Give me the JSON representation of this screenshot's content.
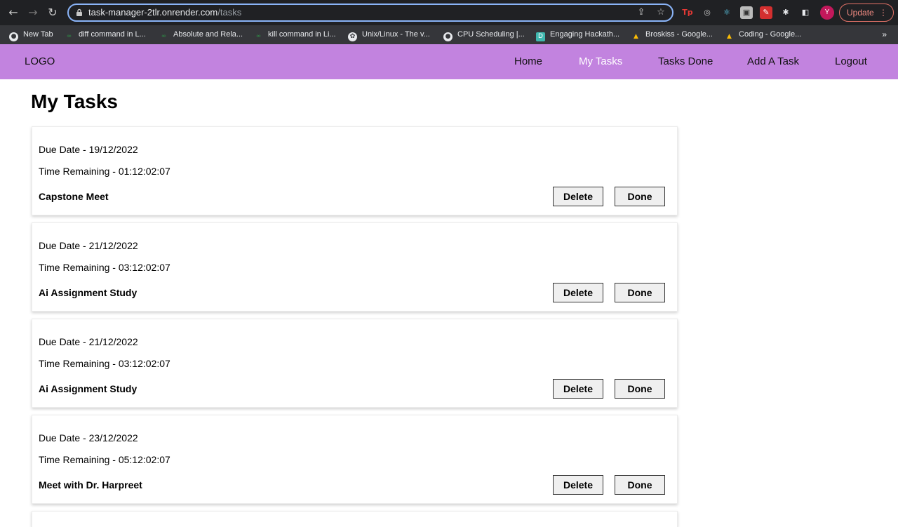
{
  "browser": {
    "url_host": "task-manager-2tlr.onrender.com",
    "url_path": "/tasks",
    "avatar_letter": "Y",
    "update_label": "Update",
    "bookmarks": [
      {
        "label": "New Tab",
        "icon": "globe-icon"
      },
      {
        "label": "diff command in L...",
        "icon": "gfg-icon"
      },
      {
        "label": "Absolute and Rela...",
        "icon": "gfg-icon"
      },
      {
        "label": "kill command in Li...",
        "icon": "gfg-icon"
      },
      {
        "label": "Unix/Linux - The v...",
        "icon": "chatgpt-icon"
      },
      {
        "label": "CPU Scheduling |...",
        "icon": "globe-icon"
      },
      {
        "label": "Engaging Hackath...",
        "icon": "devpost-icon"
      },
      {
        "label": "Broskiss - Google...",
        "icon": "drive-icon"
      },
      {
        "label": "Coding - Google...",
        "icon": "drive-icon"
      }
    ],
    "bookmarks_overflow": "»"
  },
  "site": {
    "logo": "LOGO",
    "nav": {
      "home": "Home",
      "my_tasks": "My Tasks",
      "tasks_done": "Tasks Done",
      "add_task": "Add A Task",
      "logout": "Logout"
    },
    "active_nav": "my_tasks",
    "accent_color": "#c283df"
  },
  "page": {
    "title": "My Tasks"
  },
  "tasks": [
    {
      "due": "Due Date - 19/12/2022",
      "remaining": "Time Remaining - 01:12:02:07",
      "name": "Capstone Meet",
      "delete_label": "Delete",
      "done_label": "Done"
    },
    {
      "due": "Due Date - 21/12/2022",
      "remaining": "Time Remaining - 03:12:02:07",
      "name": "Ai Assignment Study",
      "delete_label": "Delete",
      "done_label": "Done"
    },
    {
      "due": "Due Date - 21/12/2022",
      "remaining": "Time Remaining - 03:12:02:07",
      "name": "Ai Assignment Study",
      "delete_label": "Delete",
      "done_label": "Done"
    },
    {
      "due": "Due Date - 23/12/2022",
      "remaining": "Time Remaining - 05:12:02:07",
      "name": "Meet with Dr. Harpreet",
      "delete_label": "Delete",
      "done_label": "Done"
    }
  ]
}
